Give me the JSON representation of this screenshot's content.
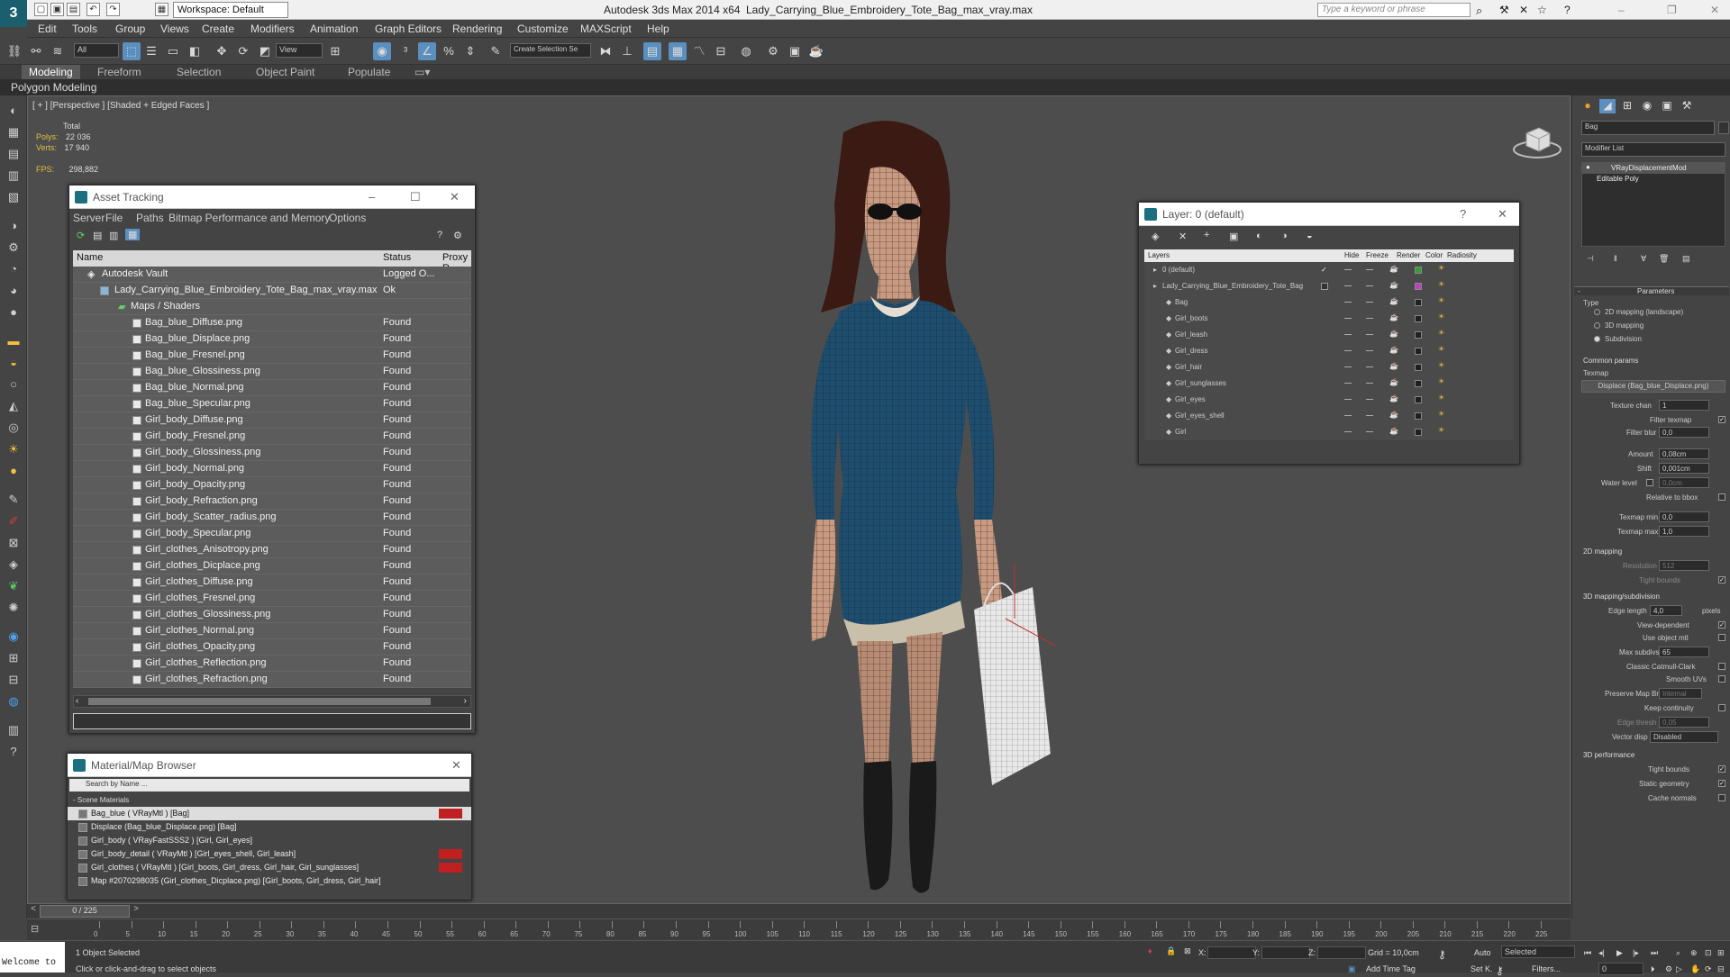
{
  "window": {
    "app_title": "Autodesk 3ds Max  2014 x64",
    "file_title": "Lady_Carrying_Blue_Embroidery_Tote_Bag_max_vray.max",
    "workspace": "Workspace: Default",
    "search_placeholder": "Type a keyword or phrase"
  },
  "menu": [
    "Edit",
    "Tools",
    "Group",
    "Views",
    "Create",
    "Modifiers",
    "Animation",
    "Graph Editors",
    "Rendering",
    "Customize",
    "MAXScript",
    "Help"
  ],
  "toolbar": {
    "filter": "All",
    "view": "View",
    "selection_set": "Create Selection Se"
  },
  "ribbon": {
    "tabs": [
      "Modeling",
      "Freeform",
      "Selection",
      "Object Paint",
      "Populate"
    ],
    "sub": "Polygon Modeling"
  },
  "viewport": {
    "label": "[ + ] [Perspective ] [Shaded + Edged Faces ]",
    "total": "Total",
    "polys_label": "Polys:",
    "polys": "22 036",
    "verts_label": "Verts:",
    "verts": "17 940",
    "fps_label": "FPS:",
    "fps": "298,882"
  },
  "asset_tracking": {
    "title": "Asset Tracking",
    "menu": [
      "Server",
      "File",
      "Paths",
      "Bitmap Performance and Memory",
      "Options"
    ],
    "cols": [
      "Name",
      "Status",
      "Proxy R"
    ],
    "vault": {
      "name": "Autodesk Vault",
      "status": "Logged O..."
    },
    "file": {
      "name": "Lady_Carrying_Blue_Embroidery_Tote_Bag_max_vray.max",
      "status": "Ok"
    },
    "maps_folder": "Maps / Shaders",
    "rows": [
      {
        "name": "Bag_blue_Diffuse.png",
        "status": "Found"
      },
      {
        "name": "Bag_blue_Displace.png",
        "status": "Found"
      },
      {
        "name": "Bag_blue_Fresnel.png",
        "status": "Found"
      },
      {
        "name": "Bag_blue_Glossiness.png",
        "status": "Found"
      },
      {
        "name": "Bag_blue_Normal.png",
        "status": "Found"
      },
      {
        "name": "Bag_blue_Specular.png",
        "status": "Found"
      },
      {
        "name": "Girl_body_Diffuse.png",
        "status": "Found"
      },
      {
        "name": "Girl_body_Fresnel.png",
        "status": "Found"
      },
      {
        "name": "Girl_body_Glossiness.png",
        "status": "Found"
      },
      {
        "name": "Girl_body_Normal.png",
        "status": "Found"
      },
      {
        "name": "Girl_body_Opacity.png",
        "status": "Found"
      },
      {
        "name": "Girl_body_Refraction.png",
        "status": "Found"
      },
      {
        "name": "Girl_body_Scatter_radius.png",
        "status": "Found"
      },
      {
        "name": "Girl_body_Specular.png",
        "status": "Found"
      },
      {
        "name": "Girl_clothes_Anisotropy.png",
        "status": "Found"
      },
      {
        "name": "Girl_clothes_Dicplace.png",
        "status": "Found"
      },
      {
        "name": "Girl_clothes_Diffuse.png",
        "status": "Found"
      },
      {
        "name": "Girl_clothes_Fresnel.png",
        "status": "Found"
      },
      {
        "name": "Girl_clothes_Glossiness.png",
        "status": "Found"
      },
      {
        "name": "Girl_clothes_Normal.png",
        "status": "Found"
      },
      {
        "name": "Girl_clothes_Opacity.png",
        "status": "Found"
      },
      {
        "name": "Girl_clothes_Reflection.png",
        "status": "Found"
      },
      {
        "name": "Girl_clothes_Refraction.png",
        "status": "Found"
      }
    ]
  },
  "layer_manager": {
    "title": "Layer: 0 (default)",
    "cols": [
      "Layers",
      "Hide",
      "Freeze",
      "Render",
      "Color",
      "Radiosity"
    ],
    "layers": [
      {
        "name": "0 (default)",
        "color": "#2fa02f"
      },
      {
        "name": "Lady_Carrying_Blue_Embroidery_Tote_Bag",
        "color": "#c040c0"
      },
      {
        "name": "Bag",
        "color": "#202020"
      },
      {
        "name": "Girl_boots",
        "color": "#202020"
      },
      {
        "name": "Girl_leash",
        "color": "#202020"
      },
      {
        "name": "Girl_dress",
        "color": "#202020"
      },
      {
        "name": "Girl_hair",
        "color": "#202020"
      },
      {
        "name": "Girl_sunglasses",
        "color": "#202020"
      },
      {
        "name": "Girl_eyes",
        "color": "#202020"
      },
      {
        "name": "Girl_eyes_shell",
        "color": "#202020"
      },
      {
        "name": "Girl",
        "color": "#202020"
      }
    ]
  },
  "material_browser": {
    "title": "Material/Map Browser",
    "search": "Search by Name ...",
    "section": "- Scene Materials",
    "items": [
      {
        "label": "Bag_blue  ( VRayMtl )  [Bag]",
        "red": true
      },
      {
        "label": "Displace (Bag_blue_Displace.png) [Bag]",
        "red": false
      },
      {
        "label": "Girl_body  ( VRayFastSSS2 )  [Girl, Girl_eyes]",
        "red": false
      },
      {
        "label": "Girl_body_detail  ( VRayMtl )  [Girl_eyes_shell, Girl_leash]",
        "red": true
      },
      {
        "label": "Girl_clothes  ( VRayMtl )  [Girl_boots, Girl_dress, Girl_hair, Girl_sunglasses]",
        "red": true
      },
      {
        "label": "Map #2070298035 (Girl_clothes_Dicplace.png) [Girl_boots, Girl_dress, Girl_hair]",
        "red": false
      }
    ]
  },
  "command_panel": {
    "object_name": "Bag",
    "modifier_list": "Modifier List",
    "stack": [
      "VRayDisplacementMod",
      "Editable Poly"
    ],
    "parameters": "Parameters",
    "type_label": "Type",
    "types": [
      "2D mapping (landscape)",
      "3D mapping",
      "Subdivision"
    ],
    "common_params": "Common params",
    "texmap_label": "Texmap",
    "texmap": "Displace (Bag_blue_Displace.png)",
    "texture_chan_label": "Texture chan",
    "texture_chan": "1",
    "filter_texmap": "Filter texmap",
    "filter_blur_label": "Filter blur",
    "filter_blur": "0,0",
    "amount_label": "Amount",
    "amount": "0,08cm",
    "shift_label": "Shift",
    "shift": "0,001cm",
    "water_level_label": "Water level",
    "water_level": "0,0cm",
    "relative_bbox": "Relative to bbox",
    "texmap_min_label": "Texmap min",
    "texmap_min": "0,0",
    "texmap_max_label": "Texmap max",
    "texmap_max": "1,0",
    "mapping2d": "2D mapping",
    "resolution_label": "Resolution",
    "resolution": "512",
    "tight_bounds": "Tight bounds",
    "mapping3d": "3D mapping/subdivision",
    "edge_length_label": "Edge length",
    "edge_length": "4,0",
    "pixels": "pixels",
    "view_dependent": "View-dependent",
    "use_object_mtl": "Use object mtl",
    "max_subdivs_label": "Max subdivs",
    "max_subdivs": "65",
    "classic_catmull": "Classic Catmull-Clark",
    "smooth_uvs": "Smooth UVs",
    "preserve_map_bnd": "Preserve Map Bnd",
    "preserve_map_bnd_value": "Internal",
    "keep_continuity": "Keep continuity",
    "edge_thresh_label": "Edge thresh",
    "edge_thresh": "0,05",
    "vector_disp_label": "Vector disp",
    "vector_disp": "Disabled",
    "performance": "3D performance",
    "static_geometry": "Static geometry",
    "cache_normals": "Cache normals"
  },
  "timeline": {
    "frame": "0 / 225",
    "ticks": [
      "0",
      "5",
      "10",
      "15",
      "20",
      "25",
      "30",
      "35",
      "40",
      "45",
      "50",
      "55",
      "60",
      "65",
      "70",
      "75",
      "80",
      "85",
      "90",
      "95",
      "100",
      "105",
      "110",
      "115",
      "120",
      "125",
      "130",
      "135",
      "140",
      "145",
      "150",
      "155",
      "160",
      "165",
      "170",
      "175",
      "180",
      "185",
      "190",
      "195",
      "200",
      "205",
      "210",
      "215",
      "220",
      "225"
    ]
  },
  "status": {
    "welcome": "Welcome to",
    "selected": "1 Object Selected",
    "hint": "Click or click-and-drag to select objects",
    "x": "X:",
    "y": "Y:",
    "z": "Z:",
    "grid": "Grid = 10,0cm",
    "add_time_tag": "Add Time Tag",
    "auto": "Auto",
    "setk": "Set K.",
    "key_mode": "Selected",
    "filters": "Filters...",
    "frame_num": "0"
  }
}
